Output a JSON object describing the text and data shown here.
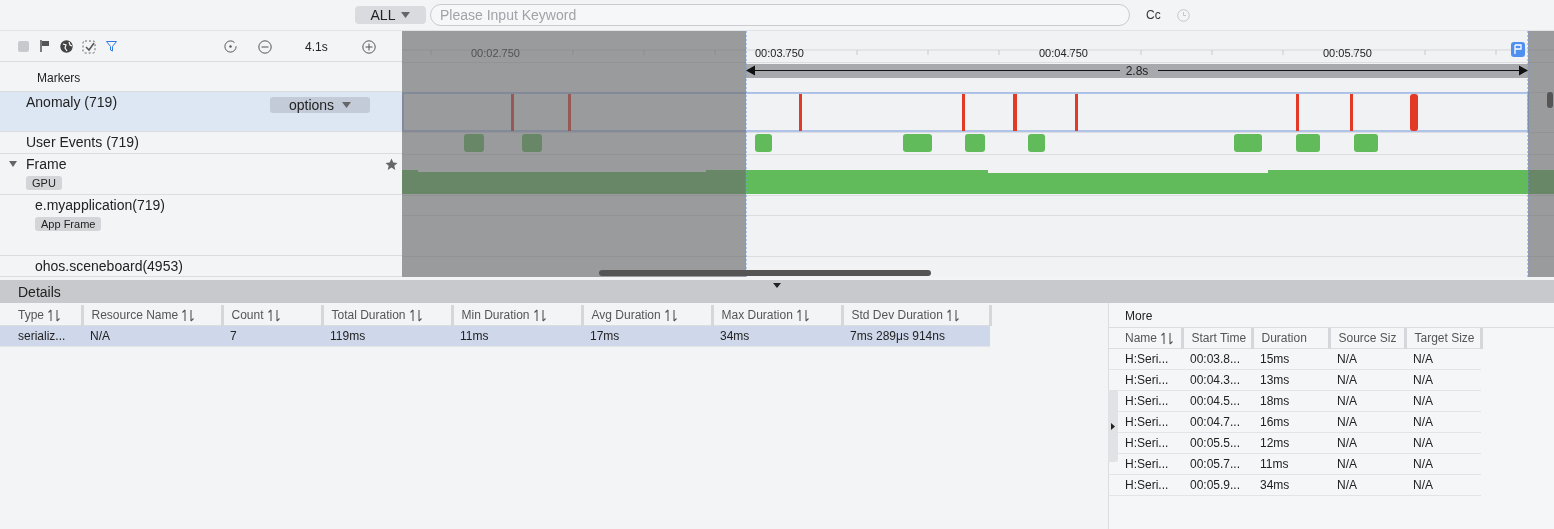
{
  "search": {
    "scope": "ALL",
    "placeholder": "Please Input Keyword",
    "case_button": "Cc"
  },
  "toolbar": {
    "zoom_label": "4.1s"
  },
  "ruler": {
    "ticks": [
      "00:02.750",
      "00:03.750",
      "00:04.750",
      "00:05.750"
    ],
    "span": "2.8s"
  },
  "tracks": [
    {
      "kind": "markers",
      "name": "Markers",
      "selected": false
    },
    {
      "kind": "anomaly",
      "name": "Anomaly (719)",
      "selected": true,
      "options": "options"
    },
    {
      "kind": "events",
      "name": "User Events (719)",
      "selected": false
    },
    {
      "kind": "group",
      "name": "Frame",
      "selected": false,
      "expanded": true,
      "tag": "GPU"
    },
    {
      "kind": "process",
      "name": "e.myapplication(719)",
      "selected": false,
      "tag": "App Frame"
    },
    {
      "kind": "process-short",
      "name": "ohos.sceneboard(4953)",
      "selected": false
    }
  ],
  "details": {
    "title": "Details",
    "columns": [
      "Type",
      "Resource Name",
      "Count",
      "Total Duration",
      "Min Duration",
      "Avg Duration",
      "Max Duration",
      "Std Dev Duration"
    ],
    "rows": [
      {
        "selected": true,
        "cells": [
          "serializ...",
          "N/A",
          "7",
          "119ms",
          "11ms",
          "17ms",
          "34ms",
          "7ms 289μs 914ns"
        ]
      }
    ]
  },
  "more": {
    "title": "More",
    "columns": [
      "Name",
      "Start Time",
      "Duration",
      "Source Siz",
      "Target Size"
    ],
    "rows": [
      [
        "H:Seri...",
        "00:03.8...",
        "15ms",
        "N/A",
        "N/A"
      ],
      [
        "H:Seri...",
        "00:04.3...",
        "13ms",
        "N/A",
        "N/A"
      ],
      [
        "H:Seri...",
        "00:04.5...",
        "18ms",
        "N/A",
        "N/A"
      ],
      [
        "H:Seri...",
        "00:04.7...",
        "16ms",
        "N/A",
        "N/A"
      ],
      [
        "H:Seri...",
        "00:05.5...",
        "12ms",
        "N/A",
        "N/A"
      ],
      [
        "H:Seri...",
        "00:05.7...",
        "11ms",
        "N/A",
        "N/A"
      ],
      [
        "H:Seri...",
        "00:05.9...",
        "34ms",
        "N/A",
        "N/A"
      ]
    ]
  }
}
